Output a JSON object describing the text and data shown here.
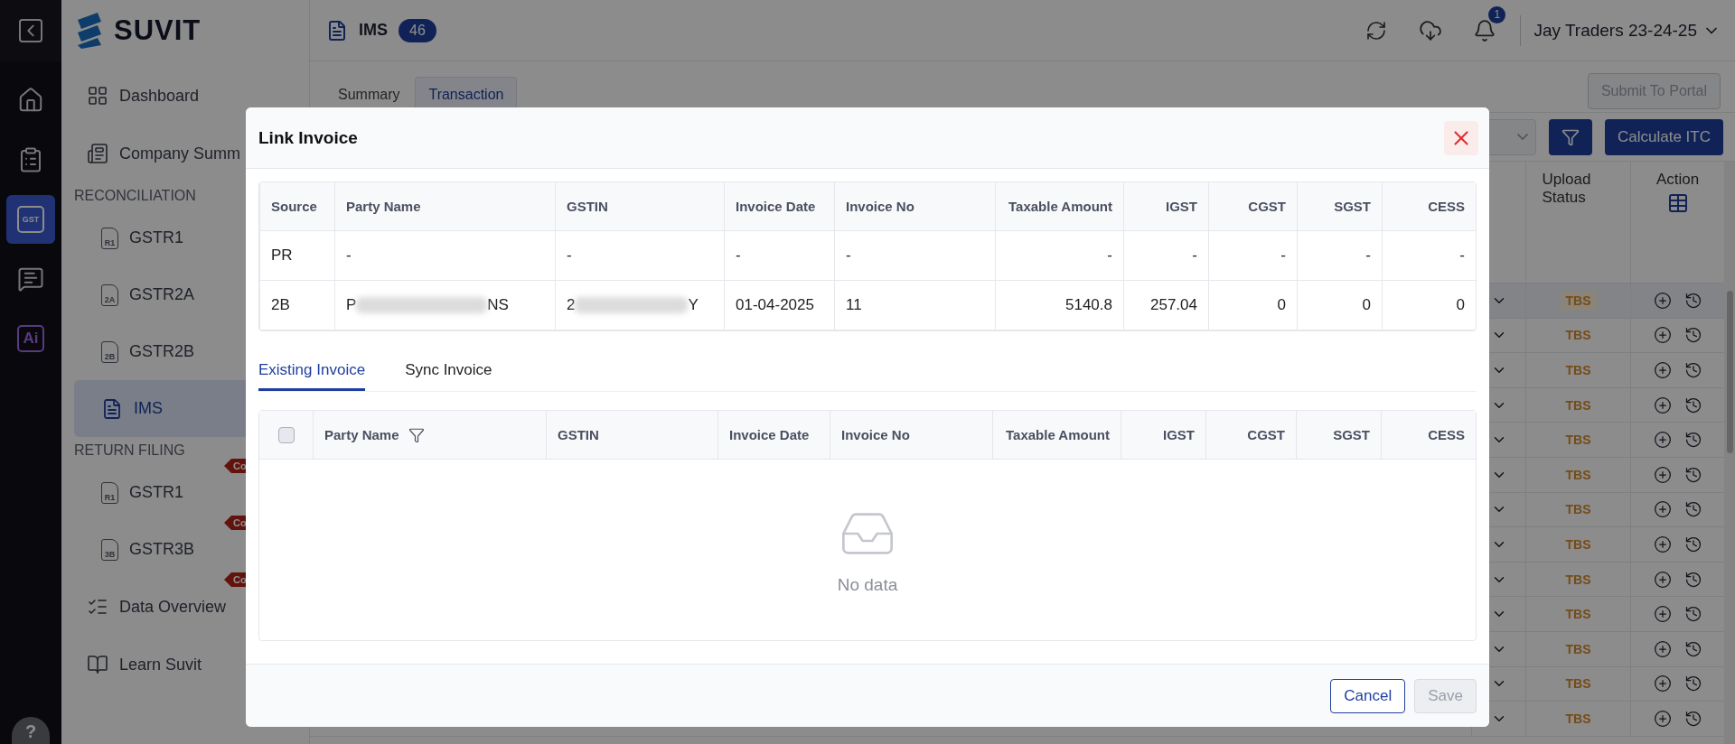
{
  "rail": {
    "items": [
      {
        "kind": "home",
        "selected": false
      },
      {
        "kind": "tasks",
        "selected": false
      },
      {
        "kind": "gst",
        "icon_text": "GST",
        "selected": true
      },
      {
        "kind": "chat",
        "selected": false
      },
      {
        "kind": "ai",
        "icon_text": "Ai",
        "selected": false
      }
    ],
    "help": "?"
  },
  "sidebar": {
    "logo": "SUVIT",
    "items": [
      {
        "kind": "item",
        "label": "Dashboard",
        "selected": false
      },
      {
        "kind": "item",
        "label": "Company Summ",
        "selected": false
      },
      {
        "kind": "heading",
        "label": "RECONCILIATION"
      },
      {
        "kind": "sub",
        "icon_text": "R1",
        "label": "GSTR1",
        "selected": false
      },
      {
        "kind": "sub",
        "icon_text": "2A",
        "label": "GSTR2A",
        "selected": false
      },
      {
        "kind": "sub",
        "icon_text": "2B",
        "label": "GSTR2B",
        "selected": false
      },
      {
        "kind": "sub",
        "label": "IMS",
        "selected": true
      },
      {
        "kind": "heading",
        "label": "RETURN FILING"
      },
      {
        "kind": "sub",
        "icon_text": "R1",
        "label": "GSTR1",
        "tag": "Co",
        "selected": false
      },
      {
        "kind": "sub",
        "icon_text": "3B",
        "label": "GSTR3B",
        "tag": "Co",
        "selected": false
      },
      {
        "kind": "item",
        "label": "Data Overview",
        "tag": "Co",
        "selected": false
      },
      {
        "kind": "item",
        "label": "Learn Suvit",
        "selected": false
      }
    ]
  },
  "header": {
    "title": "IMS",
    "count": "46",
    "notifications": "1",
    "company": "Jay Traders 23-24-25"
  },
  "tabs": [
    {
      "label": "Summary",
      "selected": false
    },
    {
      "label": "Transaction",
      "selected": true
    }
  ],
  "submit_button": {
    "label": "Submit To Portal",
    "disabled": true
  },
  "calculate_button": "Calculate ITC",
  "table": {
    "columns": [
      "Upload Status",
      "Action"
    ],
    "rows": [
      {
        "status": "TBS",
        "hovered": true
      },
      {
        "status": "TBS",
        "hovered": false
      },
      {
        "status": "TBS",
        "hovered": false
      },
      {
        "status": "TBS",
        "hovered": false
      },
      {
        "status": "TBS",
        "hovered": false
      },
      {
        "status": "TBS",
        "hovered": false
      },
      {
        "status": "TBS",
        "hovered": false
      },
      {
        "status": "TBS",
        "hovered": false
      },
      {
        "status": "TBS",
        "hovered": false
      },
      {
        "status": "TBS",
        "hovered": false
      },
      {
        "status": "TBS",
        "hovered": false
      },
      {
        "status": "TBS",
        "hovered": false
      },
      {
        "status": "TBS",
        "hovered": false
      }
    ]
  },
  "modal": {
    "title": "Link Invoice",
    "source_table": {
      "columns": [
        "Source",
        "Party Name",
        "GSTIN",
        "Invoice Date",
        "Invoice No",
        "Taxable Amount",
        "IGST",
        "CGST",
        "SGST",
        "CESS"
      ],
      "rows": [
        {
          "cells": [
            "PR",
            "-",
            "-",
            "-",
            "-",
            "-",
            "-",
            "-",
            "-",
            "-"
          ]
        },
        {
          "cells": [
            "2B",
            {
              "prefix": "P",
              "suffix": "NS"
            },
            {
              "prefix": "2",
              "suffix": "Y"
            },
            "01-04-2025",
            "11",
            "5140.8",
            "257.04",
            "0",
            "0",
            "0"
          ]
        }
      ]
    },
    "tabs": [
      {
        "label": "Existing Invoice",
        "selected": true
      },
      {
        "label": "Sync Invoice",
        "selected": false
      }
    ],
    "invoice_table": {
      "select_all": false,
      "columns": [
        "Party Name",
        "GSTIN",
        "Invoice Date",
        "Invoice No",
        "Taxable Amount",
        "IGST",
        "CGST",
        "SGST",
        "CESS"
      ],
      "empty_text": "No data"
    },
    "cancel_button": "Cancel",
    "save_button": {
      "label": "Save",
      "disabled": true
    }
  }
}
